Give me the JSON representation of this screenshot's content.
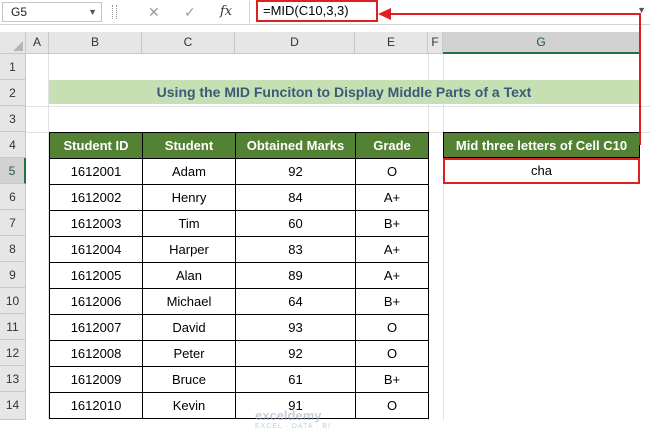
{
  "formula_bar": {
    "name_box": "G5",
    "cancel_icon": "✕",
    "enter_icon": "✓",
    "fx_label": "fx",
    "formula": "=MID(C10,3,3)"
  },
  "columns": [
    "A",
    "B",
    "C",
    "D",
    "E",
    "F",
    "G"
  ],
  "rows": [
    "1",
    "2",
    "3",
    "4",
    "5",
    "6",
    "7",
    "8",
    "9",
    "10",
    "11",
    "12",
    "13",
    "14"
  ],
  "title": "Using the MID Funciton to Display Middle Parts of a Text",
  "table": {
    "headers": [
      "Student ID",
      "Student",
      "Obtained Marks",
      "Grade"
    ],
    "rows": [
      [
        "1612001",
        "Adam",
        "92",
        "O"
      ],
      [
        "1612002",
        "Henry",
        "84",
        "A+"
      ],
      [
        "1612003",
        "Tim",
        "60",
        "B+"
      ],
      [
        "1612004",
        "Harper",
        "83",
        "A+"
      ],
      [
        "1612005",
        "Alan",
        "89",
        "A+"
      ],
      [
        "1612006",
        "Michael",
        "64",
        "B+"
      ],
      [
        "1612007",
        "David",
        "93",
        "O"
      ],
      [
        "1612008",
        "Peter",
        "92",
        "O"
      ],
      [
        "1612009",
        "Bruce",
        "61",
        "B+"
      ],
      [
        "1612010",
        "Kevin",
        "91",
        "O"
      ]
    ]
  },
  "result": {
    "header": "Mid three letters of Cell C10",
    "value": "cha"
  },
  "watermark": {
    "name": "exceldemy",
    "tagline": "EXCEL · DATA · BI"
  },
  "colors": {
    "header_green": "#548235",
    "title_green": "#c6e0b4",
    "highlight_red": "#e02020"
  }
}
